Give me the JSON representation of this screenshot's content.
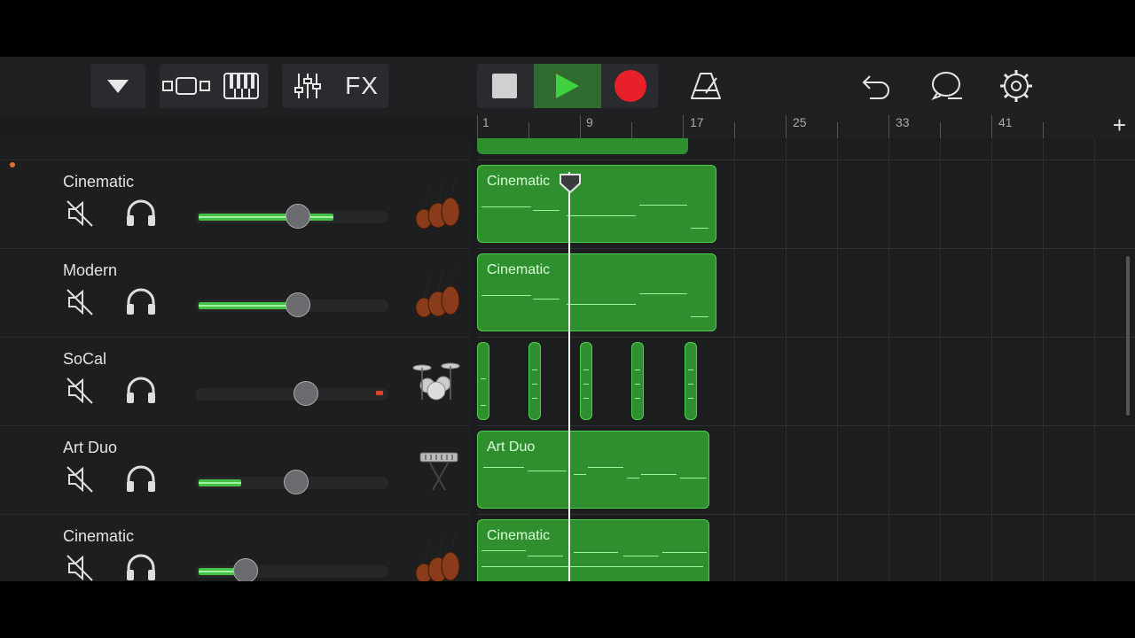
{
  "toolbar": {
    "fx_label": "FX",
    "icons": [
      "dropdown-triangle-icon",
      "tracks-view-icon",
      "keyboard-icon",
      "mixer-icon",
      "fx",
      "stop-icon",
      "play-icon",
      "record-icon",
      "metronome-icon",
      "undo-icon",
      "loop-icon",
      "settings-gear-icon"
    ]
  },
  "ruler": {
    "bars": [
      "1",
      "9",
      "17",
      "25",
      "33",
      "41"
    ],
    "add_label": "+"
  },
  "tracks": [
    {
      "name": "Cinematic",
      "volume": 0.74,
      "instrument": "strings-icon"
    },
    {
      "name": "Modern",
      "volume": 0.56,
      "instrument": "strings-icon"
    },
    {
      "name": "SoCal",
      "volume": 0.0,
      "instrument": "drum-kit-icon"
    },
    {
      "name": "Art Duo",
      "volume": 0.22,
      "instrument": "keyboard-stand-icon"
    },
    {
      "name": "Cinematic",
      "volume": 0.26,
      "instrument": "strings-icon"
    }
  ],
  "regions": [
    {
      "label": "Cinematic"
    },
    {
      "label": "Cinematic"
    },
    {
      "label": ""
    },
    {
      "label": "Art Duo"
    },
    {
      "label": "Cinematic"
    }
  ],
  "colors": {
    "region_green": "#2f8f2f",
    "volume_green": "#47c047",
    "record_red": "#e8202a",
    "play_green": "#3fd13f"
  }
}
